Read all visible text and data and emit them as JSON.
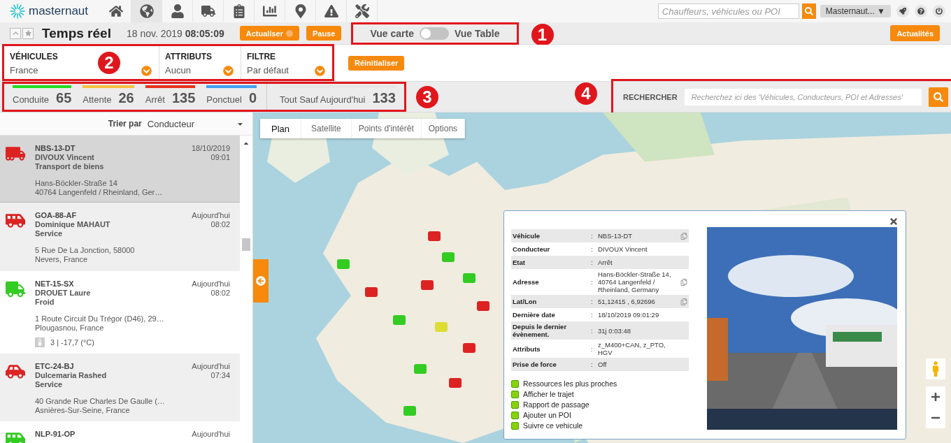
{
  "topbar": {
    "brand": "masternaut",
    "nav": [
      {
        "kind": "home",
        "selected": false
      },
      {
        "kind": "globe",
        "selected": true
      },
      {
        "kind": "user",
        "selected": false
      },
      {
        "kind": "truck",
        "selected": false
      },
      {
        "kind": "clipboard",
        "selected": false
      },
      {
        "kind": "chart",
        "selected": false
      },
      {
        "kind": "pin",
        "selected": false
      },
      {
        "kind": "warning",
        "selected": false
      },
      {
        "kind": "tools",
        "selected": false
      }
    ],
    "search": {
      "placeholder": "Chauffeurs, véhicules ou POI"
    },
    "account": "Masternaut... ▼"
  },
  "header": {
    "title": "Temps réel",
    "datetime": "18 nov. 2019 **08:05:09**",
    "refresh": "Actualiser",
    "pause": "Pause",
    "view_toggle": {
      "left": "Vue carte",
      "right": "Vue Table",
      "on": false
    },
    "news": "Actualités"
  },
  "filters": [
    {
      "label": "VÉHICULES",
      "value": "France"
    },
    {
      "label": "ATTRIBUTS",
      "value": "Aucun"
    },
    {
      "label": "FILTRE",
      "value": "Par défaut"
    }
  ],
  "reset": "Réinitialiser",
  "counts": [
    {
      "label": "Conduite",
      "value": "65",
      "color": "#22dd22"
    },
    {
      "label": "Attente",
      "value": "26",
      "color": "#f5c242"
    },
    {
      "label": "Arrêt",
      "value": "135",
      "color": "#e8321e"
    },
    {
      "label": "Ponctuel",
      "value": "0",
      "color": "#3fa0f0"
    },
    {
      "label": "Tout Sauf Aujourd'hui",
      "value": "133",
      "color": "#e6e6e6"
    }
  ],
  "search": {
    "label": "RECHERCHER",
    "placeholder": "Recherchez ici des 'Véhicules, Conducteurs, POI et Adresses'"
  },
  "callouts": [
    "1",
    "2",
    "3",
    "4"
  ],
  "sort": {
    "label": "Trier par",
    "value": "Conducteur"
  },
  "vehicles": [
    {
      "kind": "tractor",
      "color": "#dd2222",
      "plate": "NBS-13-DT",
      "driver": "DIVOUX Vincent",
      "activity": "Transport de biens",
      "address": [
        "Hans-Böckler-Straße 14",
        "40764 Langenfeld / Rheinland, Ger…"
      ],
      "date": "18/10/2019",
      "time": "09:01",
      "selected": true
    },
    {
      "kind": "van",
      "color": "#dd2222",
      "plate": "GOA-88-AF",
      "driver": "Dominique MAHAUT",
      "activity": "Service",
      "address": [
        "5 Rue De La Jonction, 58000",
        "Nevers, France"
      ],
      "date": "Aujourd'hui",
      "time": "08:02",
      "selected": false
    },
    {
      "kind": "truck",
      "color": "#33cc22",
      "plate": "NET-15-SX",
      "driver": "DROUET Laure",
      "activity": "Froid",
      "address": [
        "1 Route Circuit Du Trégor (D46), 29…",
        "Plougasnou, France"
      ],
      "sensor": "3 | -17,7 (°C)",
      "date": "Aujourd'hui",
      "time": "08:02",
      "selected": false
    },
    {
      "kind": "car",
      "color": "#dd2222",
      "plate": "ETC-24-BJ",
      "driver": "Dulcemaria Rashed",
      "activity": "Service",
      "address": [
        "40 Grande Rue Charles De Gaulle (…",
        "Asnières-Sur-Seine, France"
      ],
      "date": "Aujourd'hui",
      "time": "07:34",
      "selected": false
    },
    {
      "kind": "van",
      "color": "#33cc22",
      "plate": "NLP-91-OP",
      "date": "Aujourd'hui",
      "selected": false
    }
  ],
  "map": {
    "tabs": [
      {
        "label": "Plan",
        "selected": true
      },
      {
        "label": "Satellite",
        "selected": false
      },
      {
        "label": "Points d'intérêt",
        "selected": false
      },
      {
        "label": "Options",
        "selected": false
      }
    ],
    "popup": {
      "rows": [
        {
          "label": "Véhicule",
          "sep": ":",
          "value": "NBS-13-DT",
          "copy": true
        },
        {
          "label": "Conducteur",
          "sep": ":",
          "value": "DIVOUX Vincent",
          "copy": false
        },
        {
          "label": "Etat",
          "sep": ":",
          "value": "Arrêt",
          "copy": false
        },
        {
          "label": "Adresse",
          "sep": ":",
          "value": "Hans-Böckler-Straße 14, 40764 Langenfeld / Rheinland, Germany",
          "copy": true
        },
        {
          "label": "Lat/Lon",
          "sep": ":",
          "value": "51,12415 , 6,92696",
          "copy": true
        },
        {
          "label": "Dernière date",
          "sep": ":",
          "value": "18/10/2019 09:01:29",
          "copy": false
        },
        {
          "label": "Depuis le dernier évènement.",
          "sep": ":",
          "value": "31j 0:03:48",
          "copy": false
        },
        {
          "label": "Attributs",
          "sep": ":",
          "value": "z_M400+CAN, z_PTO, HGV",
          "copy": false
        },
        {
          "label": "Prise de force",
          "sep": ":",
          "value": "Off",
          "copy": false
        }
      ],
      "actions": [
        "Ressources les plus proches",
        "Afficher le trajet",
        "Rapport de passage",
        "Ajouter un POI",
        "Suivre ce vehicule"
      ]
    }
  }
}
